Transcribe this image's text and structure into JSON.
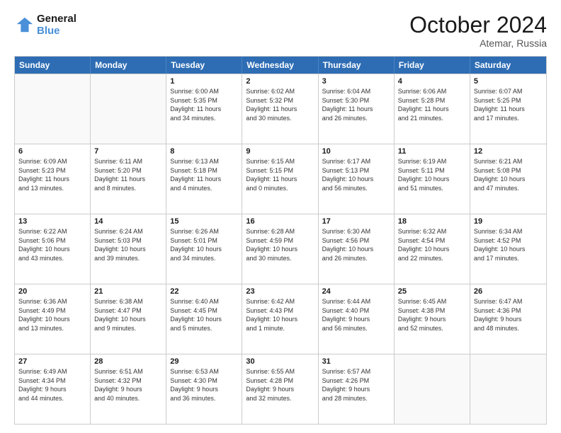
{
  "header": {
    "logo_line1": "General",
    "logo_line2": "Blue",
    "main_title": "October 2024",
    "subtitle": "Atemar, Russia"
  },
  "calendar": {
    "days_of_week": [
      "Sunday",
      "Monday",
      "Tuesday",
      "Wednesday",
      "Thursday",
      "Friday",
      "Saturday"
    ],
    "rows": [
      [
        {
          "day": "",
          "sunrise": "",
          "sunset": "",
          "daylight": "",
          "empty": true
        },
        {
          "day": "",
          "sunrise": "",
          "sunset": "",
          "daylight": "",
          "empty": true
        },
        {
          "day": "1",
          "line1": "Sunrise: 6:00 AM",
          "line2": "Sunset: 5:35 PM",
          "line3": "Daylight: 11 hours",
          "line4": "and 34 minutes."
        },
        {
          "day": "2",
          "line1": "Sunrise: 6:02 AM",
          "line2": "Sunset: 5:32 PM",
          "line3": "Daylight: 11 hours",
          "line4": "and 30 minutes."
        },
        {
          "day": "3",
          "line1": "Sunrise: 6:04 AM",
          "line2": "Sunset: 5:30 PM",
          "line3": "Daylight: 11 hours",
          "line4": "and 26 minutes."
        },
        {
          "day": "4",
          "line1": "Sunrise: 6:06 AM",
          "line2": "Sunset: 5:28 PM",
          "line3": "Daylight: 11 hours",
          "line4": "and 21 minutes."
        },
        {
          "day": "5",
          "line1": "Sunrise: 6:07 AM",
          "line2": "Sunset: 5:25 PM",
          "line3": "Daylight: 11 hours",
          "line4": "and 17 minutes."
        }
      ],
      [
        {
          "day": "6",
          "line1": "Sunrise: 6:09 AM",
          "line2": "Sunset: 5:23 PM",
          "line3": "Daylight: 11 hours",
          "line4": "and 13 minutes."
        },
        {
          "day": "7",
          "line1": "Sunrise: 6:11 AM",
          "line2": "Sunset: 5:20 PM",
          "line3": "Daylight: 11 hours",
          "line4": "and 8 minutes."
        },
        {
          "day": "8",
          "line1": "Sunrise: 6:13 AM",
          "line2": "Sunset: 5:18 PM",
          "line3": "Daylight: 11 hours",
          "line4": "and 4 minutes."
        },
        {
          "day": "9",
          "line1": "Sunrise: 6:15 AM",
          "line2": "Sunset: 5:15 PM",
          "line3": "Daylight: 11 hours",
          "line4": "and 0 minutes."
        },
        {
          "day": "10",
          "line1": "Sunrise: 6:17 AM",
          "line2": "Sunset: 5:13 PM",
          "line3": "Daylight: 10 hours",
          "line4": "and 56 minutes."
        },
        {
          "day": "11",
          "line1": "Sunrise: 6:19 AM",
          "line2": "Sunset: 5:11 PM",
          "line3": "Daylight: 10 hours",
          "line4": "and 51 minutes."
        },
        {
          "day": "12",
          "line1": "Sunrise: 6:21 AM",
          "line2": "Sunset: 5:08 PM",
          "line3": "Daylight: 10 hours",
          "line4": "and 47 minutes."
        }
      ],
      [
        {
          "day": "13",
          "line1": "Sunrise: 6:22 AM",
          "line2": "Sunset: 5:06 PM",
          "line3": "Daylight: 10 hours",
          "line4": "and 43 minutes."
        },
        {
          "day": "14",
          "line1": "Sunrise: 6:24 AM",
          "line2": "Sunset: 5:03 PM",
          "line3": "Daylight: 10 hours",
          "line4": "and 39 minutes."
        },
        {
          "day": "15",
          "line1": "Sunrise: 6:26 AM",
          "line2": "Sunset: 5:01 PM",
          "line3": "Daylight: 10 hours",
          "line4": "and 34 minutes."
        },
        {
          "day": "16",
          "line1": "Sunrise: 6:28 AM",
          "line2": "Sunset: 4:59 PM",
          "line3": "Daylight: 10 hours",
          "line4": "and 30 minutes."
        },
        {
          "day": "17",
          "line1": "Sunrise: 6:30 AM",
          "line2": "Sunset: 4:56 PM",
          "line3": "Daylight: 10 hours",
          "line4": "and 26 minutes."
        },
        {
          "day": "18",
          "line1": "Sunrise: 6:32 AM",
          "line2": "Sunset: 4:54 PM",
          "line3": "Daylight: 10 hours",
          "line4": "and 22 minutes."
        },
        {
          "day": "19",
          "line1": "Sunrise: 6:34 AM",
          "line2": "Sunset: 4:52 PM",
          "line3": "Daylight: 10 hours",
          "line4": "and 17 minutes."
        }
      ],
      [
        {
          "day": "20",
          "line1": "Sunrise: 6:36 AM",
          "line2": "Sunset: 4:49 PM",
          "line3": "Daylight: 10 hours",
          "line4": "and 13 minutes."
        },
        {
          "day": "21",
          "line1": "Sunrise: 6:38 AM",
          "line2": "Sunset: 4:47 PM",
          "line3": "Daylight: 10 hours",
          "line4": "and 9 minutes."
        },
        {
          "day": "22",
          "line1": "Sunrise: 6:40 AM",
          "line2": "Sunset: 4:45 PM",
          "line3": "Daylight: 10 hours",
          "line4": "and 5 minutes."
        },
        {
          "day": "23",
          "line1": "Sunrise: 6:42 AM",
          "line2": "Sunset: 4:43 PM",
          "line3": "Daylight: 10 hours",
          "line4": "and 1 minute."
        },
        {
          "day": "24",
          "line1": "Sunrise: 6:44 AM",
          "line2": "Sunset: 4:40 PM",
          "line3": "Daylight: 9 hours",
          "line4": "and 56 minutes."
        },
        {
          "day": "25",
          "line1": "Sunrise: 6:45 AM",
          "line2": "Sunset: 4:38 PM",
          "line3": "Daylight: 9 hours",
          "line4": "and 52 minutes."
        },
        {
          "day": "26",
          "line1": "Sunrise: 6:47 AM",
          "line2": "Sunset: 4:36 PM",
          "line3": "Daylight: 9 hours",
          "line4": "and 48 minutes."
        }
      ],
      [
        {
          "day": "27",
          "line1": "Sunrise: 6:49 AM",
          "line2": "Sunset: 4:34 PM",
          "line3": "Daylight: 9 hours",
          "line4": "and 44 minutes."
        },
        {
          "day": "28",
          "line1": "Sunrise: 6:51 AM",
          "line2": "Sunset: 4:32 PM",
          "line3": "Daylight: 9 hours",
          "line4": "and 40 minutes."
        },
        {
          "day": "29",
          "line1": "Sunrise: 6:53 AM",
          "line2": "Sunset: 4:30 PM",
          "line3": "Daylight: 9 hours",
          "line4": "and 36 minutes."
        },
        {
          "day": "30",
          "line1": "Sunrise: 6:55 AM",
          "line2": "Sunset: 4:28 PM",
          "line3": "Daylight: 9 hours",
          "line4": "and 32 minutes."
        },
        {
          "day": "31",
          "line1": "Sunrise: 6:57 AM",
          "line2": "Sunset: 4:26 PM",
          "line3": "Daylight: 9 hours",
          "line4": "and 28 minutes."
        },
        {
          "day": "",
          "line1": "",
          "line2": "",
          "line3": "",
          "line4": "",
          "empty": true
        },
        {
          "day": "",
          "line1": "",
          "line2": "",
          "line3": "",
          "line4": "",
          "empty": true
        }
      ]
    ]
  }
}
